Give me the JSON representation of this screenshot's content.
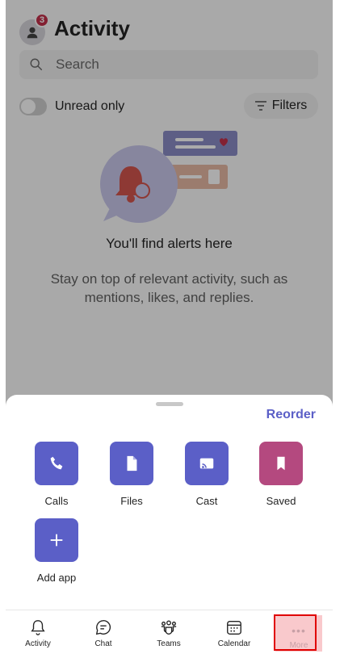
{
  "header": {
    "title": "Activity",
    "notification_count": "3"
  },
  "search": {
    "placeholder": "Search"
  },
  "filters_row": {
    "unread_label": "Unread only",
    "unread_on": false,
    "filters_label": "Filters"
  },
  "empty_state": {
    "title": "You'll find alerts here",
    "description": "Stay on top of relevant activity, such as mentions, likes, and replies."
  },
  "sheet": {
    "reorder_label": "Reorder",
    "apps": [
      {
        "label": "Calls",
        "icon": "phone-icon",
        "color": "#5b5fc7"
      },
      {
        "label": "Files",
        "icon": "file-icon",
        "color": "#5b5fc7"
      },
      {
        "label": "Cast",
        "icon": "cast-icon",
        "color": "#5b5fc7"
      },
      {
        "label": "Saved",
        "icon": "bookmark-icon",
        "color": "#b4497f"
      },
      {
        "label": "Add app",
        "icon": "plus-icon",
        "color": "#5b5fc7"
      }
    ]
  },
  "tabbar": {
    "tabs": [
      {
        "label": "Activity",
        "icon": "bell-icon"
      },
      {
        "label": "Chat",
        "icon": "chat-icon"
      },
      {
        "label": "Teams",
        "icon": "teams-icon"
      },
      {
        "label": "Calendar",
        "icon": "calendar-icon"
      },
      {
        "label": "More",
        "icon": "more-dots-icon",
        "highlighted": true
      }
    ]
  },
  "colors": {
    "accent": "#5b5fc7",
    "badge": "#c4314b",
    "highlight_border": "#e00000"
  }
}
